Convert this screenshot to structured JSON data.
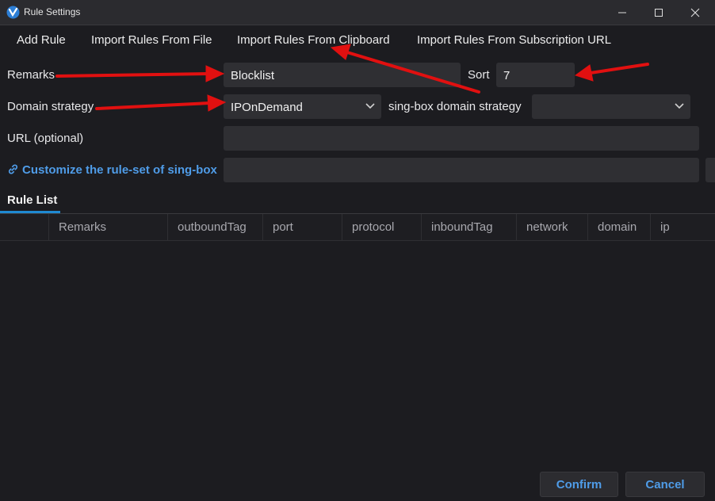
{
  "window": {
    "title": "Rule Settings"
  },
  "menu": {
    "add_rule": "Add Rule",
    "import_file": "Import Rules From File",
    "import_clipboard": "Import Rules From Clipboard",
    "import_subscription": "Import Rules From Subscription URL"
  },
  "form": {
    "remarks_label": "Remarks",
    "remarks_value": "Blocklist",
    "sort_label": "Sort",
    "sort_value": "7",
    "domain_strategy_label": "Domain strategy",
    "domain_strategy_value": "IPOnDemand",
    "singbox_strategy_label": "sing-box domain strategy",
    "singbox_strategy_value": "",
    "url_label": "URL (optional)",
    "url_value": "",
    "ruleset_label": "Customize the rule-set of sing-box",
    "ruleset_value": ""
  },
  "tabs": [
    {
      "label": "Rule List"
    }
  ],
  "table": {
    "columns": [
      "Remarks",
      "outboundTag",
      "port",
      "protocol",
      "inboundTag",
      "network",
      "domain",
      "ip"
    ]
  },
  "footer": {
    "confirm": "Confirm",
    "cancel": "Cancel"
  },
  "colors": {
    "accent": "#4f9ce8",
    "tab_underline": "#1f8ad2",
    "annotation_arrow": "#e11010"
  }
}
